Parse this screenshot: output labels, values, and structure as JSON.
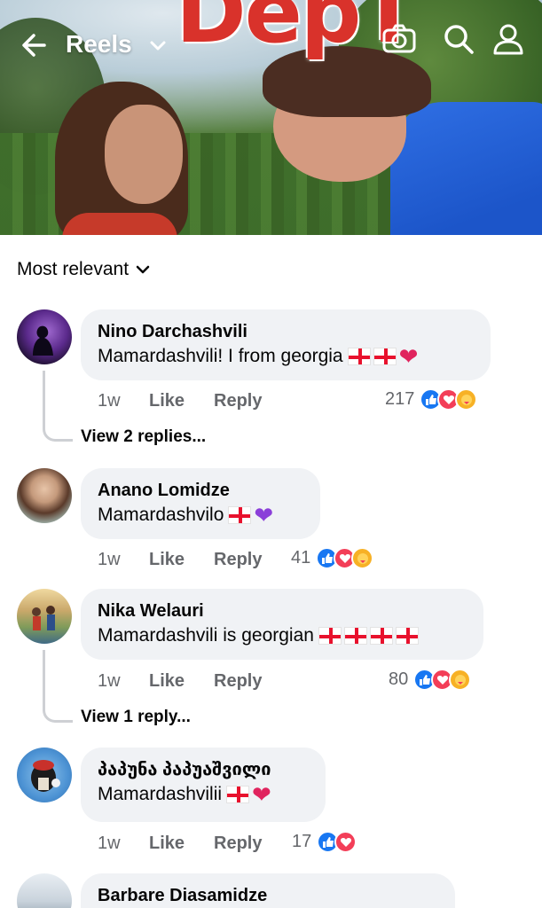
{
  "header": {
    "title": "Reels",
    "video_overlay_text": "DepT"
  },
  "sort": {
    "label": "Most relevant"
  },
  "comments": [
    {
      "name": "Nino Darchashvili",
      "text": "Mamardashvili! I from georgia",
      "time": "1w",
      "like": "Like",
      "reply": "Reply",
      "reaction_count": "217",
      "view_replies": "View 2 replies..."
    },
    {
      "name": "Anano Lomidze",
      "text": "Mamardashvilo",
      "time": "1w",
      "like": "Like",
      "reply": "Reply",
      "reaction_count": "41"
    },
    {
      "name": "Nika Welauri",
      "text": "Mamardashvili is georgian",
      "time": "1w",
      "like": "Like",
      "reply": "Reply",
      "reaction_count": "80",
      "view_replies": "View 1 reply..."
    },
    {
      "name": "პაპუნა პაპუაშვილი",
      "text": "Mamardashvilii",
      "time": "1w",
      "like": "Like",
      "reply": "Reply",
      "reaction_count": "17"
    },
    {
      "name": "Barbare Diasamidze"
    }
  ],
  "colors": {
    "like_blue": "#1877f2",
    "love_red": "#f33e58",
    "bubble_bg": "#f0f2f5",
    "meta_gray": "#65676b"
  }
}
